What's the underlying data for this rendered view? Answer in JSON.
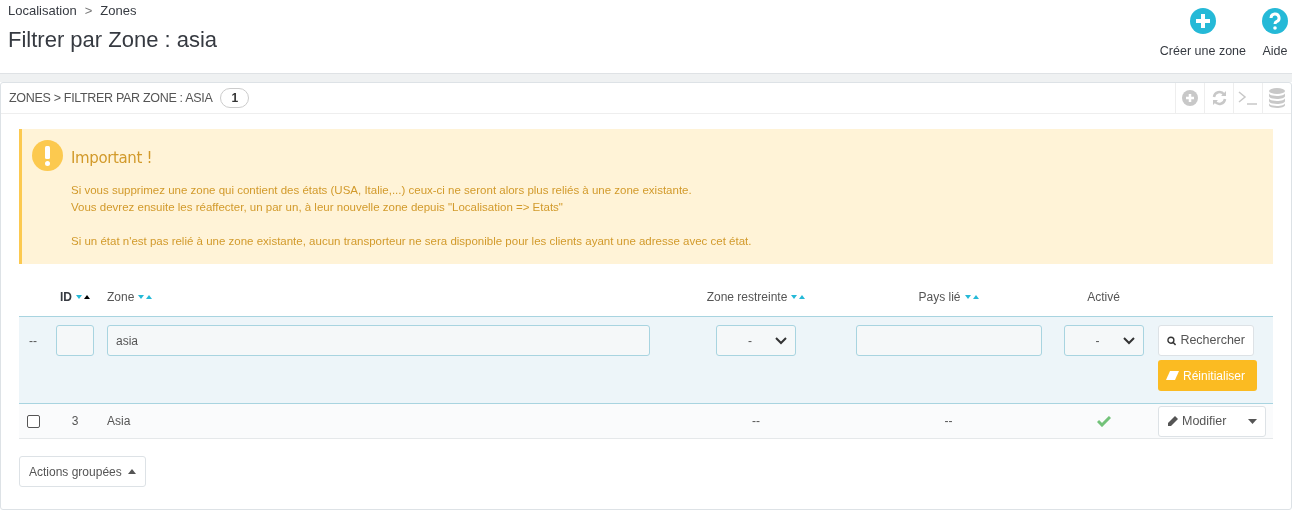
{
  "breadcrumb": [
    "Localisation",
    "Zones"
  ],
  "breadcrumb_separator": ">",
  "page_title": "Filtrer par Zone : asia",
  "toolbar": [
    {
      "kind": "add",
      "label": "Créer une zone"
    },
    {
      "kind": "help",
      "label": "Aide"
    }
  ],
  "panel": {
    "title": "ZONES > FILTRER PAR ZONE : ASIA",
    "count": "1"
  },
  "alert": {
    "title": "Important !",
    "paragraphs": [
      [
        "Si vous supprimez une zone qui contient des états (USA, Italie,...) ceux-ci ne seront alors plus reliés à une zone existante.",
        "Vous devrez ensuite les réaffecter, un par un, à leur nouvelle zone depuis \"Localisation => Etats\""
      ],
      [
        "Si un état n'est pas relié à une zone existante, aucun transporteur ne sera disponible pour les clients ayant une adresse avec cet état."
      ]
    ]
  },
  "table": {
    "columns": [
      {
        "label": "ID",
        "sortable": true,
        "sorted_asc": true
      },
      {
        "label": "Zone",
        "sortable": true,
        "sorted_asc": false
      },
      {
        "label": "Zone restreinte",
        "sortable": true,
        "sorted_asc": false
      },
      {
        "label": "Pays lié",
        "sortable": true,
        "sorted_asc": false
      },
      {
        "label": "Activé"
      }
    ],
    "filter": {
      "bulk": "--",
      "zone": "asia",
      "restricted": "-",
      "active": "-",
      "search_button": "Rechercher",
      "reset_button": "Réinitialiser"
    },
    "rows": [
      {
        "checked": false,
        "id": "3",
        "zone": "Asia",
        "restricted": "--",
        "country": "--",
        "active": true,
        "action": "Modifier"
      }
    ]
  },
  "bulk_button": "Actions groupées"
}
